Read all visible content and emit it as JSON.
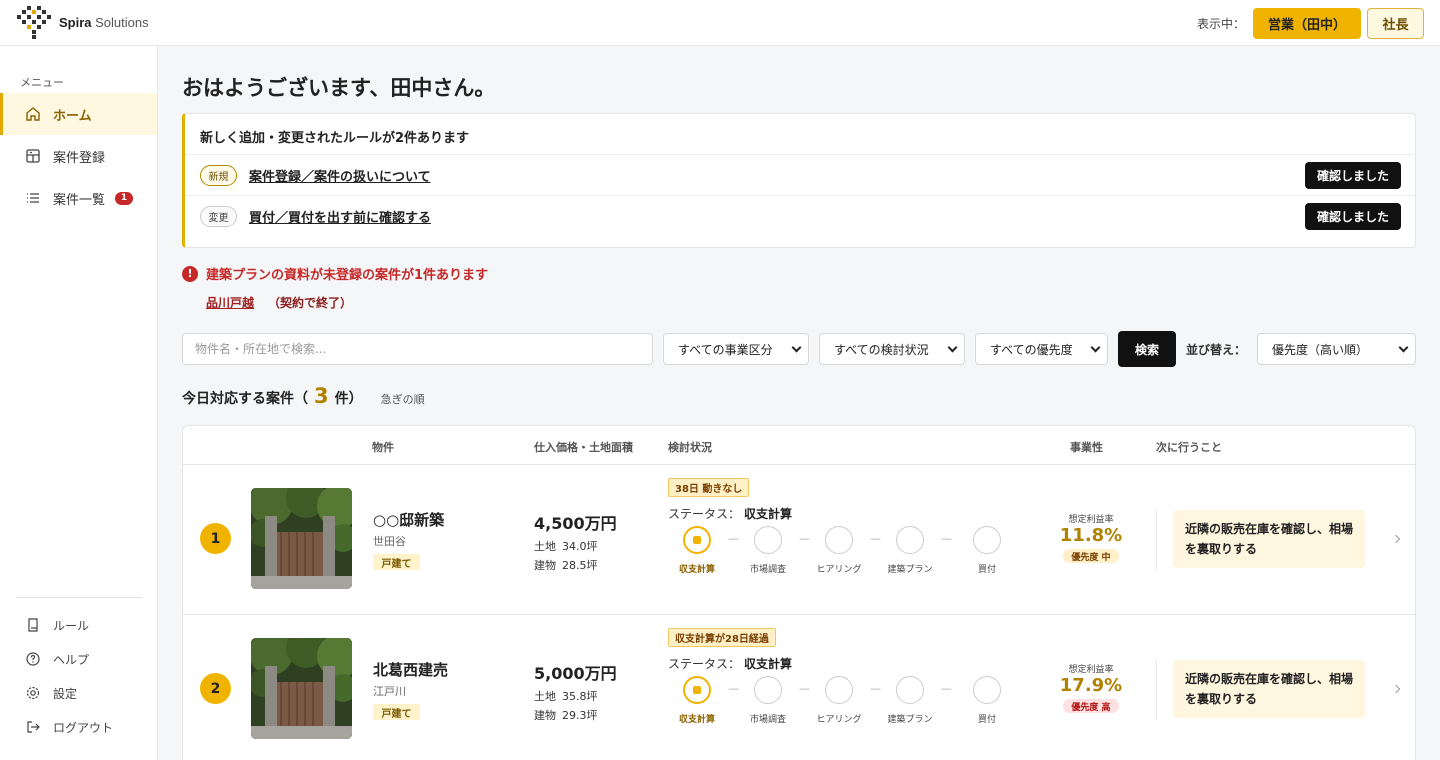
{
  "app": {
    "logo_bold": "Spira",
    "logo_light": " Solutions",
    "viewing_label": "表示中：",
    "role_active": "営業（田中）",
    "role_other": "社長",
    "colors": {
      "accent": "#f0b400",
      "danger": "#c62828",
      "dark": "#111111"
    }
  },
  "sidebar": {
    "heading": "メニュー",
    "items": [
      {
        "label": "ホーム",
        "icon": "home-icon",
        "active": true
      },
      {
        "label": "案件登録",
        "icon": "register-icon"
      },
      {
        "label": "案件一覧",
        "icon": "list-icon",
        "badge": "1"
      }
    ],
    "bottom": [
      {
        "label": "ルール",
        "icon": "book-icon"
      },
      {
        "label": "ヘルプ",
        "icon": "help-icon"
      },
      {
        "label": "設定",
        "icon": "gear-icon"
      },
      {
        "label": "ログアウト",
        "icon": "logout-icon"
      }
    ]
  },
  "main": {
    "greeting": "おはようございます、田中さん。",
    "rules": {
      "title": "新しく追加・変更されたルールが2件あります",
      "items": [
        {
          "tag": "新規",
          "text": "案件登録／案件の扱いについて",
          "button": "確認しました"
        },
        {
          "tag": "変更",
          "text": "買付／買付を出す前に確認する",
          "button": "確認しました"
        }
      ]
    },
    "alert": {
      "icon": "!",
      "text": "建築プランの資料が未登録の案件が1件あります",
      "link": "品川戸越",
      "note": "（契約で終了）"
    },
    "filters": {
      "search_placeholder": "物件名・所在地で検索...",
      "business_type": "すべての事業区分",
      "review_status": "すべての検討状況",
      "priority": "すべての優先度",
      "search_button": "検索",
      "sort_label": "並び替え：",
      "sort_value": "優先度（高い順）"
    },
    "today": {
      "title_prefix": "今日対応する案件（",
      "count": "3",
      "title_suffix": "件）",
      "order_note": "急ぎの順"
    },
    "table": {
      "headers": {
        "property": "物件",
        "price_area": "仕入価格・土地面積",
        "status": "検討状況",
        "business": "事業性",
        "next": "次に行うこと"
      },
      "step_names": [
        "収支計算",
        "市場調査",
        "ヒアリング",
        "建築プラン",
        "買付"
      ],
      "status_label": "ステータス：",
      "profit_label": "想定利益率",
      "land_label": "土地",
      "building_label": "建物",
      "rows": [
        {
          "rank": "1",
          "name": "○○邸新築",
          "area": "世田谷",
          "type": "戸建て",
          "price": "4,500万円",
          "land": "34.0坪",
          "building": "28.5坪",
          "warning": "38日 動きなし",
          "status": "収支計算",
          "profit": "11.8%",
          "priority": "優先度 中",
          "priority_level": "mid",
          "next": "近隣の販売在庫を確認し、相場を裏取りする"
        },
        {
          "rank": "2",
          "name": "北葛西建売",
          "area": "江戸川",
          "type": "戸建て",
          "price": "5,000万円",
          "land": "35.8坪",
          "building": "29.3坪",
          "warning": "収支計算が28日経過",
          "status": "収支計算",
          "profit": "17.9%",
          "priority": "優先度 高",
          "priority_level": "high",
          "next": "近隣の販売在庫を確認し、相場を裏取りする"
        }
      ]
    }
  }
}
